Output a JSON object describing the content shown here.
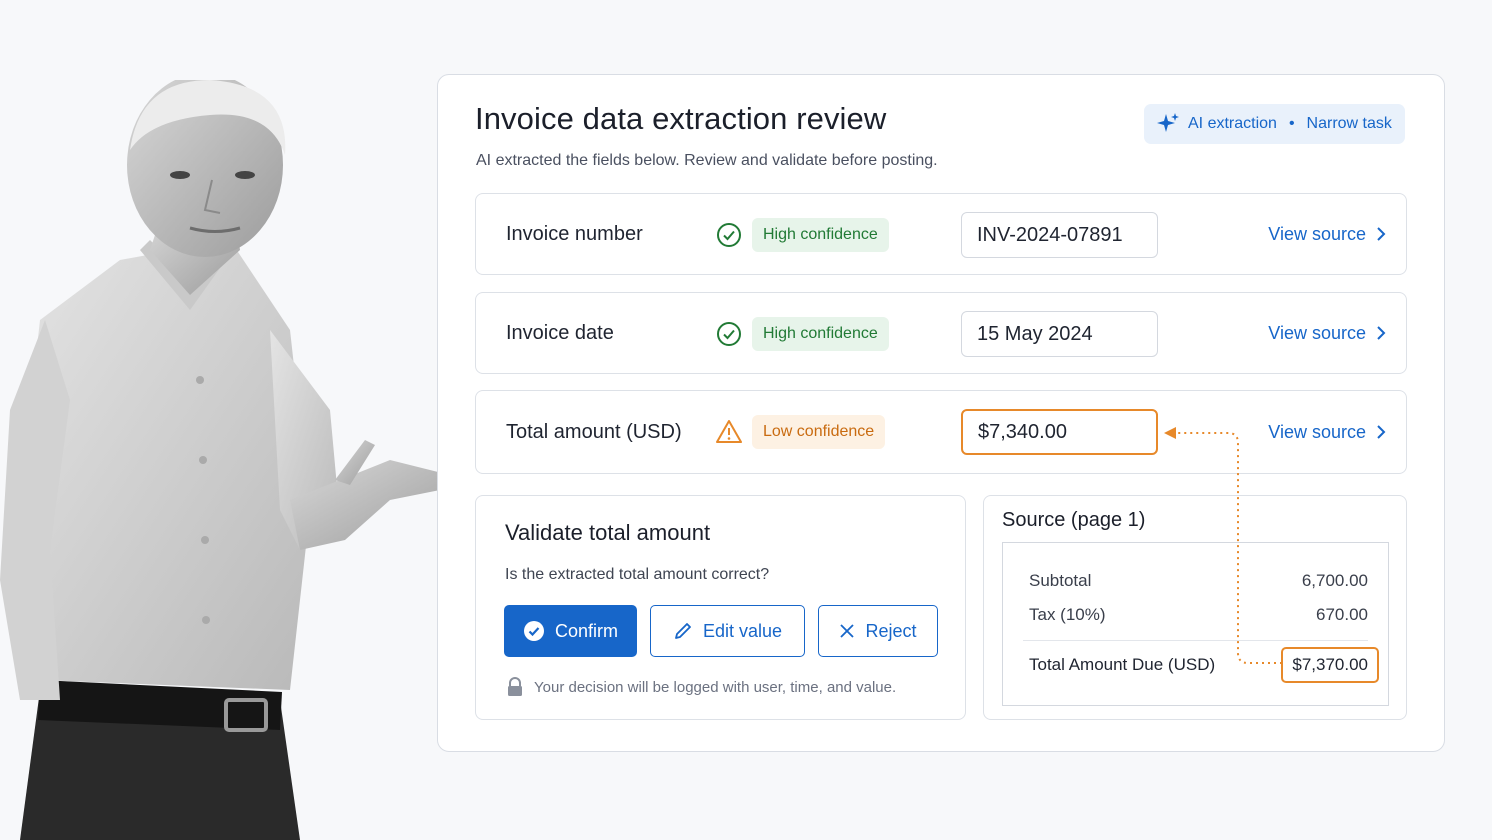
{
  "header": {
    "title": "Invoice data extraction review",
    "subtitle": "AI extracted the fields below. Review and validate before posting.",
    "ai_badge": {
      "label": "AI extraction",
      "separator": "•",
      "task": "Narrow task"
    }
  },
  "fields": [
    {
      "label": "Invoice number",
      "confidence": "High confidence",
      "value": "INV-2024-07891",
      "link": "View source"
    },
    {
      "label": "Invoice date",
      "confidence": "High confidence",
      "value": "15 May 2024",
      "link": "View source"
    },
    {
      "label": "Total amount (USD)",
      "confidence": "Low confidence",
      "value": "$7,340.00",
      "link": "View source"
    }
  ],
  "validate": {
    "title": "Validate total amount",
    "question": "Is the extracted total amount correct?",
    "confirm_label": "Confirm",
    "edit_label": "Edit value",
    "reject_label": "Reject",
    "log_note": "Your decision will be logged with user, time, and value."
  },
  "source": {
    "title": "Source (page 1)",
    "rows": [
      {
        "label": "Subtotal",
        "value": "6,700.00"
      },
      {
        "label": "Tax (10%)",
        "value": "670.00"
      }
    ],
    "total": {
      "label": "Total Amount Due (USD)",
      "value": "$7,370.00"
    }
  },
  "colors": {
    "accent": "#1766c9",
    "high_confidence": "#217a35",
    "low_confidence": "#e7892a"
  }
}
